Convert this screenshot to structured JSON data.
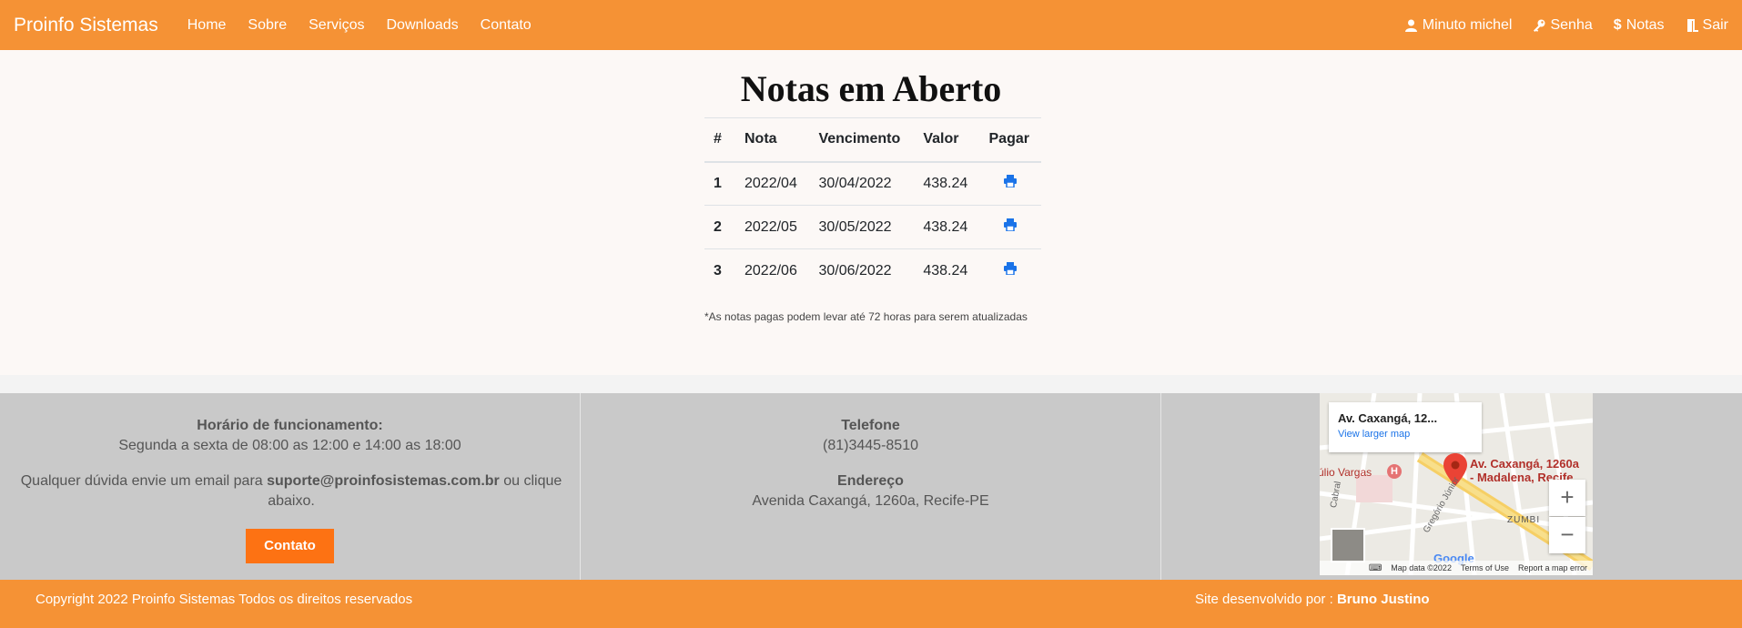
{
  "navbar": {
    "brand": "Proinfo Sistemas",
    "links": [
      "Home",
      "Sobre",
      "Serviços",
      "Downloads",
      "Contato"
    ],
    "user": "Minuto michel",
    "senha": "Senha",
    "notas": "Notas",
    "sair": "Sair",
    "icons": [
      "user-icon",
      "key-icon",
      "dollar-icon",
      "door-icon"
    ]
  },
  "main": {
    "title": "Notas em Aberto",
    "headers": [
      "#",
      "Nota",
      "Vencimento",
      "Valor",
      "Pagar"
    ],
    "rows": [
      {
        "num": "1",
        "nota": "2022/04",
        "vencimento": "30/04/2022",
        "valor": "438.24"
      },
      {
        "num": "2",
        "nota": "2022/05",
        "vencimento": "30/05/2022",
        "valor": "438.24"
      },
      {
        "num": "3",
        "nota": "2022/06",
        "vencimento": "30/06/2022",
        "valor": "438.24"
      }
    ],
    "note": "*As notas pagas podem levar até 72 horas para serem atualizadas"
  },
  "footer": {
    "horario_title": "Horário de funcionamento:",
    "horario_text": "Segunda a sexta de 08:00 as 12:00 e 14:00 as 18:00",
    "duvida_pre": "Qualquer dúvida envie um email para ",
    "email": "suporte@proinfosistemas.com.br",
    "duvida_post": " ou clique abaixo.",
    "contato_button": "Contato",
    "telefone_title": "Telefone",
    "telefone": "(81)3445-8510",
    "endereco_title": "Endereço",
    "endereco": "Avenida Caxangá, 1260a, Recife-PE"
  },
  "map": {
    "card_address": "Av. Caxangá, 12...",
    "view_larger": "View larger map",
    "pin_label_1": "Av. Caxangá, 1260a",
    "pin_label_2": "- Madalena, Recife...",
    "poi_vargas": "úlio Vargas",
    "zumbi": "ZUMBI",
    "street": "Gregório Júnior",
    "cabral": "Cabral",
    "google": "Google",
    "map_data": "Map data ©2022",
    "terms": "Terms of Use",
    "report": "Report a map error",
    "zoom_in": "+",
    "zoom_out": "−"
  },
  "bottom": {
    "copyright": "Copyright 2022 Proinfo Sistemas Todos os direitos reservados",
    "dev_prefix": "Site desenvolvido por : ",
    "dev_name": "Bruno Justino"
  },
  "colors": {
    "brand_orange": "#f59235",
    "button_orange": "#fd7213",
    "link_blue": "#1a73e8",
    "footer_gray": "#c9c9c9"
  }
}
